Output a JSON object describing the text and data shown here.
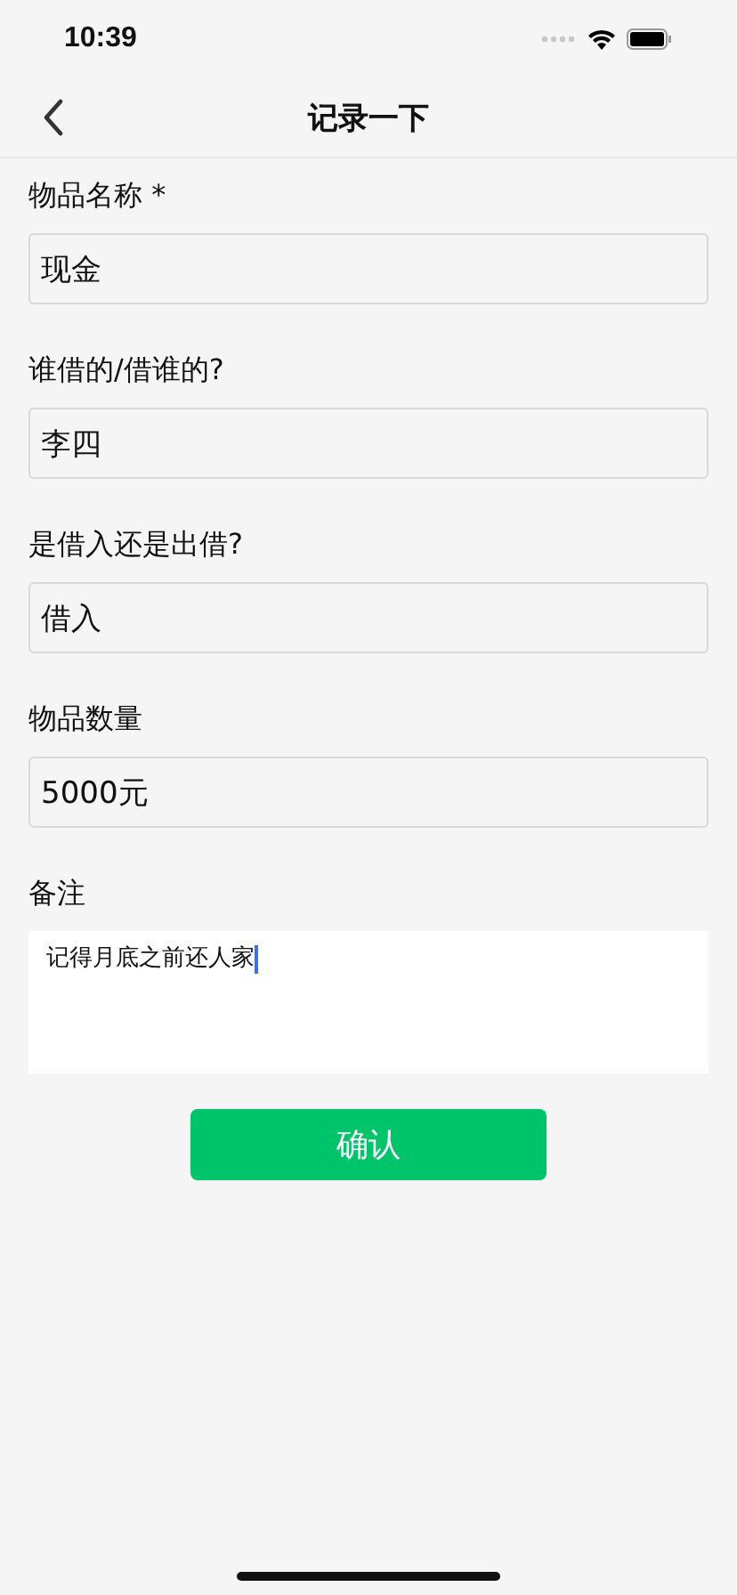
{
  "status_bar": {
    "time": "10:39"
  },
  "nav_bar": {
    "title": "记录一下"
  },
  "fields": [
    {
      "kind": "input",
      "label": "物品名称 *",
      "value": "现金",
      "focused": false
    },
    {
      "kind": "input",
      "label": "谁借的/借谁的?",
      "value": "李四",
      "focused": false
    },
    {
      "kind": "input",
      "label": "是借入还是出借?",
      "value": "借入",
      "focused": false
    },
    {
      "kind": "input",
      "label": "物品数量",
      "value": "5000元",
      "focused": false
    },
    {
      "kind": "textarea",
      "label": "备注",
      "value": "记得月底之前还人家",
      "focused": true
    }
  ],
  "submit": "确认"
}
